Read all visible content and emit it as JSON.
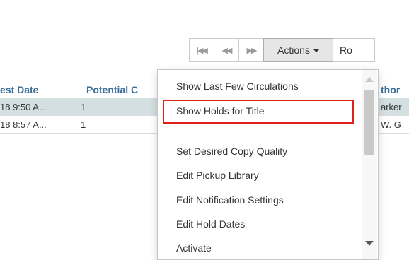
{
  "toolbar": {
    "first_icon": "first-page-icon",
    "prev_icon": "previous-page-icon",
    "next_icon": "next-page-icon",
    "actions_label": "Actions",
    "row_label": "Ro"
  },
  "grid": {
    "columns": [
      "est Date",
      "Potential C",
      "thor"
    ],
    "rows": [
      {
        "date": "18 9:50 A...",
        "potential": "1",
        "author": "arker",
        "selected": true
      },
      {
        "date": "18 8:57 A...",
        "potential": "1",
        "author": "W. G",
        "selected": false
      }
    ]
  },
  "menu": {
    "items": [
      "Show Last Few Circulations",
      "Show Holds for Title",
      "Set Desired Copy Quality",
      "Edit Pickup Library",
      "Edit Notification Settings",
      "Edit Hold Dates",
      "Activate"
    ],
    "highlighted_index": 1
  },
  "colors": {
    "highlight_border": "#e0201b",
    "selected_row": "#d3dfe1",
    "header_text": "#3a6f9a"
  }
}
